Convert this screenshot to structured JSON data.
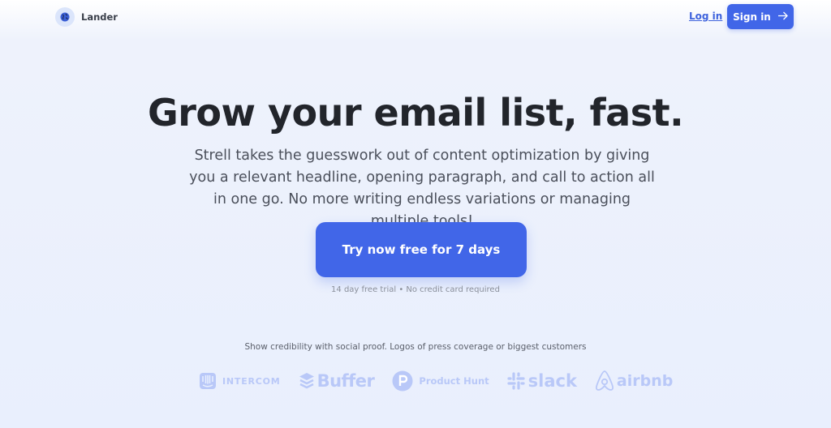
{
  "nav": {
    "brand_name": "Lander",
    "brand_icon": "globe-icon",
    "login_label": "Log in",
    "signin_label": "Sign in",
    "signin_icon": "arrow-right-icon"
  },
  "hero": {
    "headline": "Grow your email list, fast.",
    "subheadline": "Strell takes the guesswork out of content optimization by giving you a relevant headline, opening paragraph, and call to action all in one go. No more writing endless variations or managing multiple tools!",
    "cta_label": "Try now free for 7 days",
    "cta_note": "14 day free trial • No credit card required"
  },
  "social_proof": {
    "caption": "Show credibility with social proof. Logos of press coverage or biggest customers",
    "logos": [
      {
        "name": "INTERCOM",
        "icon": "intercom-icon"
      },
      {
        "name": "Buffer",
        "icon": "buffer-icon"
      },
      {
        "name": "Product Hunt",
        "icon": "product-hunt-icon"
      },
      {
        "name": "slack",
        "icon": "slack-icon"
      },
      {
        "name": "airbnb",
        "icon": "airbnb-icon"
      }
    ]
  },
  "colors": {
    "accent": "#4166e8",
    "logo_tint": "#b9c8f8",
    "background": "#e9effd"
  }
}
